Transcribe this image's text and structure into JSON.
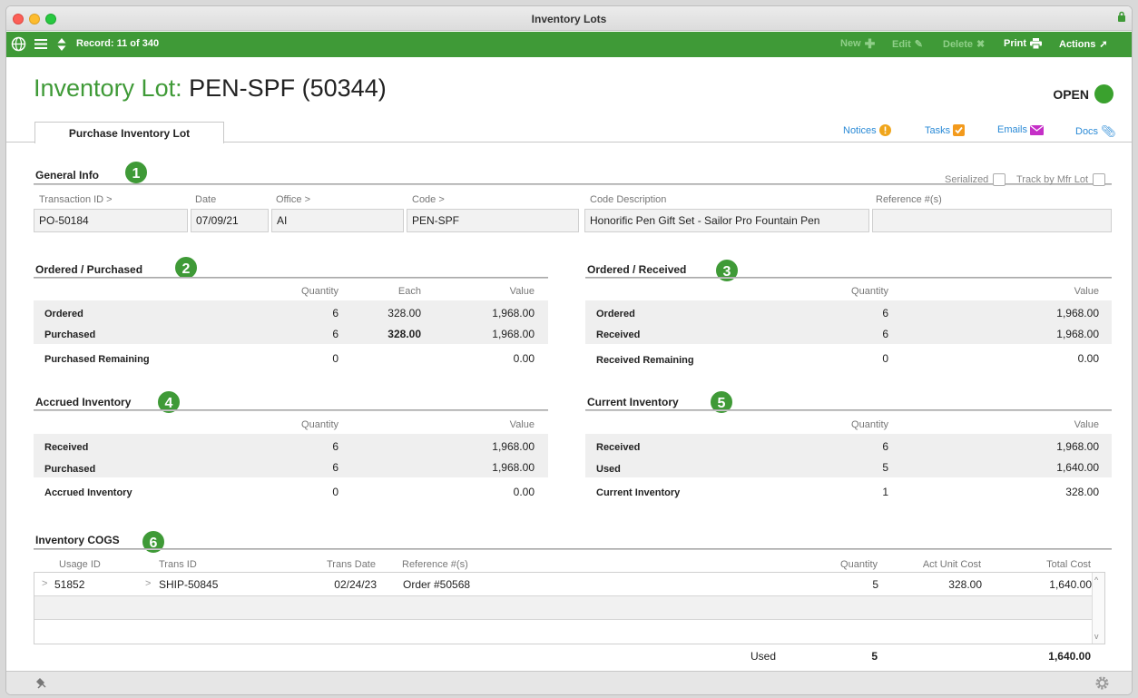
{
  "window": {
    "title": "Inventory Lots"
  },
  "toolbar": {
    "record": "Record: 11 of 340",
    "new_label": "New",
    "edit_label": "Edit",
    "delete_label": "Delete",
    "print_label": "Print",
    "actions_label": "Actions"
  },
  "header": {
    "title_label": "Inventory Lot:",
    "title_value": "PEN-SPF (50344)",
    "status": "OPEN"
  },
  "tabs": [
    {
      "label": "Purchase Inventory Lot"
    }
  ],
  "links": {
    "notices": "Notices",
    "tasks": "Tasks",
    "emails": "Emails",
    "docs": "Docs"
  },
  "general_info": {
    "title": "General Info",
    "badge": "1",
    "serialized_label": "Serialized",
    "track_label": "Track by Mfr Lot",
    "fields": {
      "transaction_id": {
        "label": "Transaction ID >",
        "value": "PO-50184"
      },
      "date": {
        "label": "Date",
        "value": "07/09/21"
      },
      "office": {
        "label": "Office >",
        "value": "AI"
      },
      "code": {
        "label": "Code >",
        "value": "PEN-SPF"
      },
      "code_description": {
        "label": "Code Description",
        "value": "Honorific Pen Gift Set - Sailor Pro Fountain Pen"
      },
      "reference": {
        "label": "Reference #(s)",
        "value": ""
      }
    }
  },
  "ordered_purchased": {
    "title": "Ordered / Purchased",
    "badge": "2",
    "headers": [
      "Quantity",
      "Each",
      "Value"
    ],
    "rows": [
      {
        "label": "Ordered",
        "qty": "6",
        "each": "328.00",
        "value": "1,968.00"
      },
      {
        "label": "Purchased",
        "qty": "6",
        "each": "328.00",
        "value": "1,968.00"
      },
      {
        "label": "Purchased Remaining",
        "qty": "0",
        "each": "",
        "value": "0.00"
      }
    ]
  },
  "ordered_received": {
    "title": "Ordered / Received",
    "badge": "3",
    "headers": [
      "Quantity",
      "Value"
    ],
    "rows": [
      {
        "label": "Ordered",
        "qty": "6",
        "value": "1,968.00"
      },
      {
        "label": "Received",
        "qty": "6",
        "value": "1,968.00"
      },
      {
        "label": "Received Remaining",
        "qty": "0",
        "value": "0.00"
      }
    ]
  },
  "accrued_inventory": {
    "title": "Accrued Inventory",
    "badge": "4",
    "headers": [
      "Quantity",
      "Value"
    ],
    "rows": [
      {
        "label": "Received",
        "qty": "6",
        "value": "1,968.00"
      },
      {
        "label": "Purchased",
        "qty": "6",
        "value": "1,968.00"
      },
      {
        "label": "Accrued Inventory",
        "qty": "0",
        "value": "0.00"
      }
    ]
  },
  "current_inventory": {
    "title": "Current Inventory",
    "badge": "5",
    "headers": [
      "Quantity",
      "Value"
    ],
    "rows": [
      {
        "label": "Received",
        "qty": "6",
        "value": "1,968.00"
      },
      {
        "label": "Used",
        "qty": "5",
        "value": "1,640.00"
      },
      {
        "label": "Current Inventory",
        "qty": "1",
        "value": "328.00"
      }
    ]
  },
  "cogs": {
    "title": "Inventory COGS",
    "badge": "6",
    "headers": [
      "Usage ID",
      "Trans ID",
      "Trans Date",
      "Reference #(s)",
      "Quantity",
      "Act Unit Cost",
      "Total Cost"
    ],
    "rows": [
      {
        "usage_id": "51852",
        "trans_id": "SHIP-50845",
        "trans_date": "02/24/23",
        "reference": "Order #50568",
        "qty": "5",
        "unit_cost": "328.00",
        "total_cost": "1,640.00"
      }
    ],
    "total_label": "Used",
    "total_qty": "5",
    "total_cost": "1,640.00"
  }
}
